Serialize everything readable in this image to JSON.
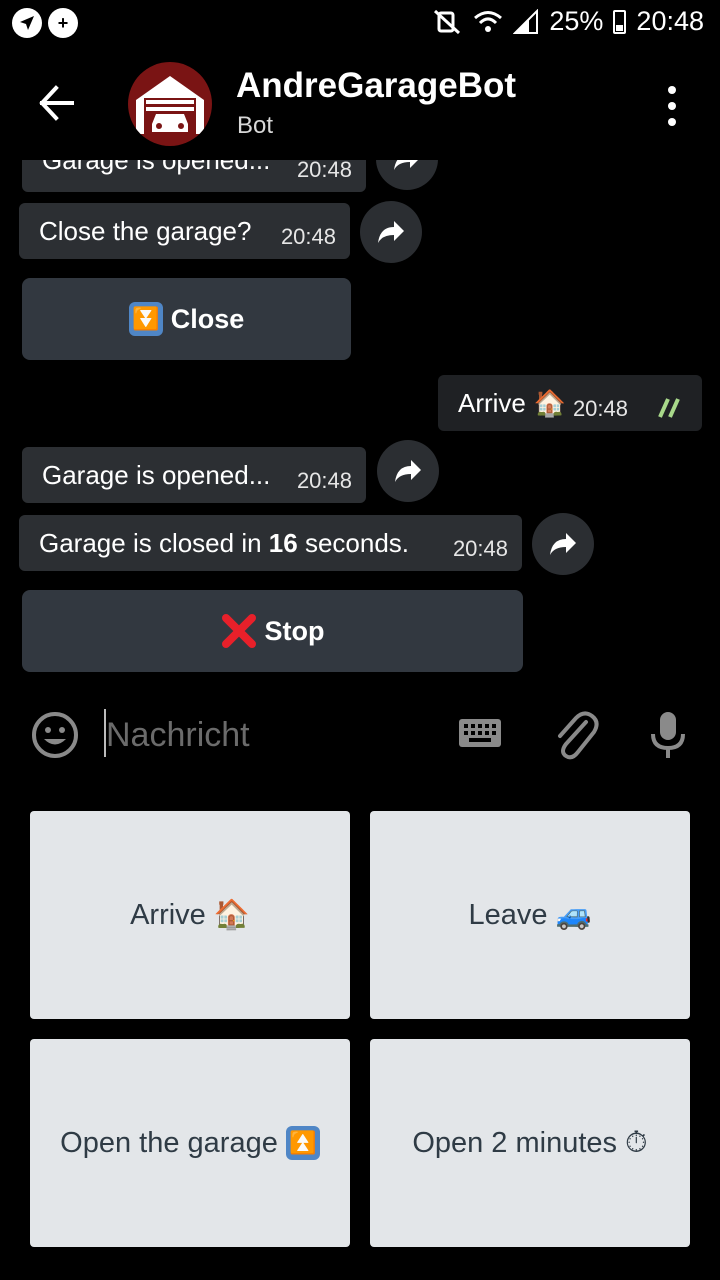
{
  "status_bar": {
    "battery": "25%",
    "time": "20:48"
  },
  "header": {
    "title": "AndreGarageBot",
    "subtitle": "Bot"
  },
  "messages": [
    {
      "text": "Garage is opened...",
      "time": "20:48"
    },
    {
      "text": "Close the garage?",
      "time": "20:48"
    },
    {
      "inline_button": "Close"
    },
    {
      "text": "Arrive",
      "time": "20:48",
      "outgoing": true
    },
    {
      "text": "Garage is opened...",
      "time": "20:48"
    },
    {
      "text_prefix": "Garage is closed in ",
      "text_bold": "16",
      "text_suffix": " seconds.",
      "time": "20:48"
    },
    {
      "inline_button": "Stop"
    }
  ],
  "input": {
    "placeholder": "Nachricht"
  },
  "reply_keyboard": [
    {
      "label": "Arrive",
      "icon": "house-emoji"
    },
    {
      "label": "Leave",
      "icon": "car-emoji"
    },
    {
      "label": "Open the garage",
      "icon": "double-up-arrow-emoji"
    },
    {
      "label": "Open 2 minutes",
      "icon": "stopwatch-emoji"
    }
  ],
  "colors": {
    "background": "#000000",
    "bubble": "#2c2f33",
    "inline_button": "#323840",
    "keyboard_button": "#e3e6e9",
    "read_check": "#a8d88a"
  }
}
